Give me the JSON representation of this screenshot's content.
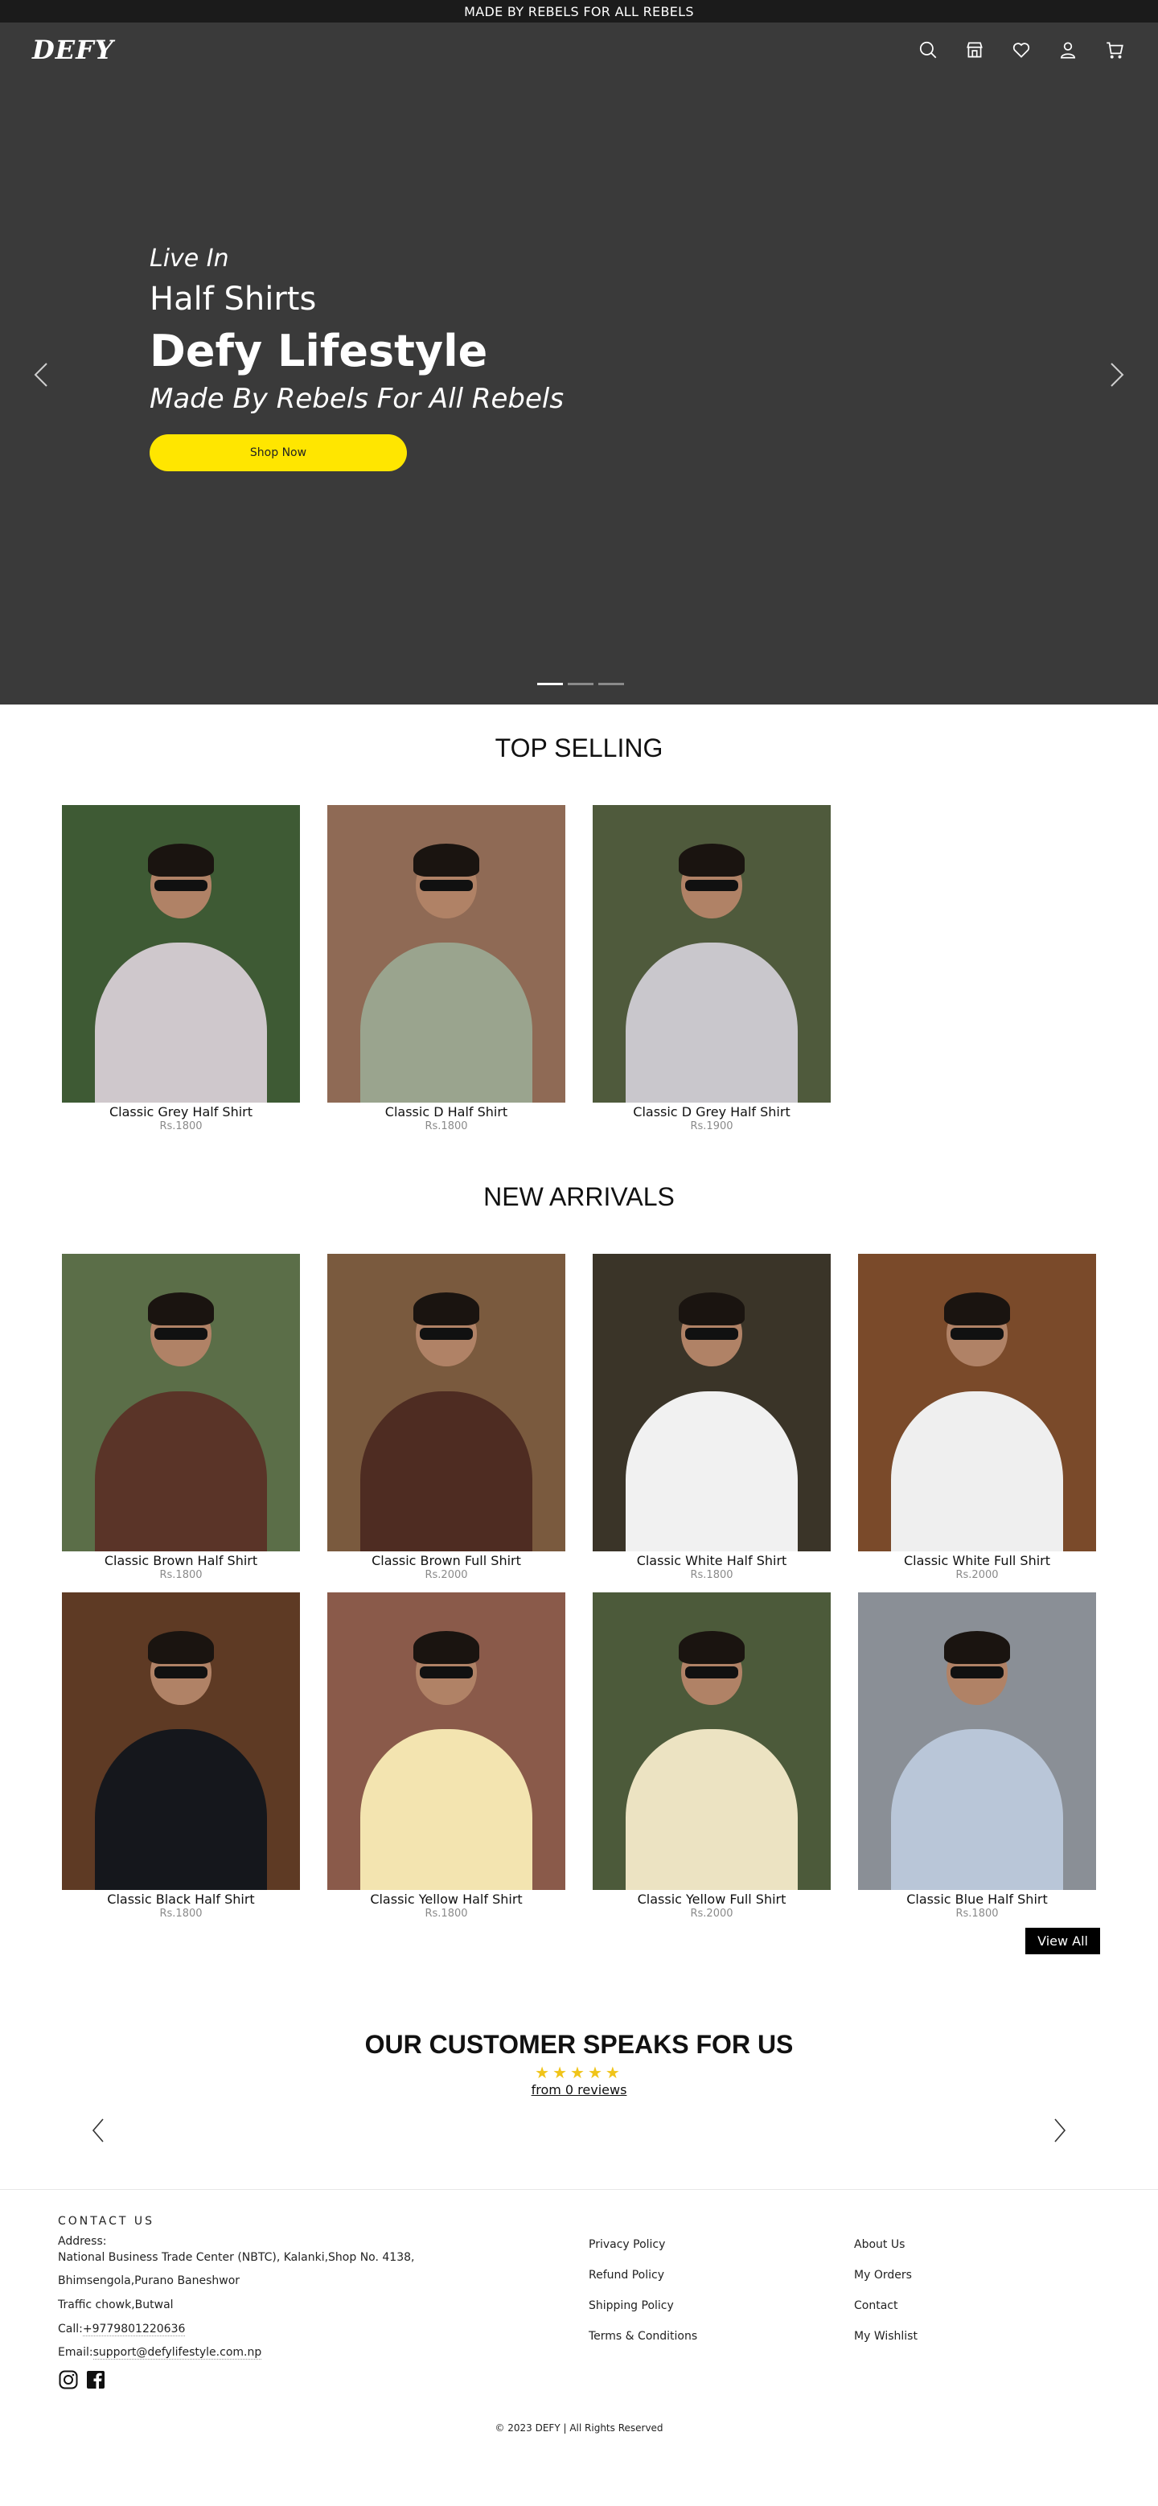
{
  "announcement": "MADE BY REBELS FOR ALL REBELS",
  "brand": {
    "logo": "DEFY"
  },
  "header_icons": [
    "search-icon",
    "store-icon",
    "heart-icon",
    "user-icon",
    "cart-icon"
  ],
  "hero": {
    "pre": "Live In",
    "category": "Half Shirts",
    "title": "Defy Lifestyle",
    "subtitle": "Made By Rebels For All Rebels",
    "button": "Shop Now",
    "slides": 3,
    "active_slide": 1,
    "button_color": "#ffe600",
    "background": "#3a3a3a"
  },
  "top_selling": {
    "title": "TOP SELLING",
    "products": [
      {
        "name": "Classic Grey Half Shirt",
        "price": "Rs.1800",
        "bg": "#3e5a34",
        "shirt": "#cfc8cc"
      },
      {
        "name": "Classic D Half Shirt",
        "price": "Rs.1800",
        "bg": "#8f6a55",
        "shirt": "#9aa48e"
      },
      {
        "name": "Classic D Grey Half Shirt",
        "price": "Rs.1900",
        "bg": "#4f5a3c",
        "shirt": "#c9c7cc"
      }
    ]
  },
  "new_arrivals": {
    "title": "NEW ARRIVALS",
    "products": [
      {
        "name": "Classic Brown Half Shirt",
        "price": "Rs.1800",
        "bg": "#5b6e48",
        "shirt": "#5a3428"
      },
      {
        "name": "Classic Brown Full Shirt",
        "price": "Rs.2000",
        "bg": "#7a5a3e",
        "shirt": "#4e2c22"
      },
      {
        "name": "Classic White Half Shirt",
        "price": "Rs.1800",
        "bg": "#3a3428",
        "shirt": "#f1f1f1"
      },
      {
        "name": "Classic White Full Shirt",
        "price": "Rs.2000",
        "bg": "#7a4a2a",
        "shirt": "#efefef"
      },
      {
        "name": "Classic Black Half Shirt",
        "price": "Rs.1800",
        "bg": "#5e3a24",
        "shirt": "#15171c"
      },
      {
        "name": "Classic Yellow Half Shirt",
        "price": "Rs.1800",
        "bg": "#8a5a4a",
        "shirt": "#f3e4b0"
      },
      {
        "name": "Classic Yellow Full Shirt",
        "price": "Rs.2000",
        "bg": "#4c5a3a",
        "shirt": "#ece3c2"
      },
      {
        "name": "Classic Blue Half Shirt",
        "price": "Rs.1800",
        "bg": "#8a8f96",
        "shirt": "#b9c6d8"
      }
    ],
    "view_all": "View All"
  },
  "reviews": {
    "title": "OUR CUSTOMER SPEAKS FOR US",
    "stars": "★★★★★",
    "count_link": "from 0 reviews"
  },
  "footer": {
    "contact_heading": "CONTACT US",
    "address_label": "Address:",
    "address_line1": "National Business Trade Center (NBTC), Kalanki,Shop No. 4138,",
    "address_line2": "Bhimsengola,Purano Baneshwor",
    "address_line3": "Traffic chowk,Butwal",
    "call_label": "Call:",
    "phone": "+9779801220636",
    "email_label": "Email:",
    "email": "support@defylifestyle.com.np",
    "policies": [
      "Privacy Policy",
      "Refund Policy",
      "Shipping Policy",
      "Terms & Conditions"
    ],
    "links": [
      "About Us",
      "My Orders",
      "Contact",
      "My Wishlist"
    ],
    "copyright": "© 2023 DEFY | All Rights Reserved"
  }
}
